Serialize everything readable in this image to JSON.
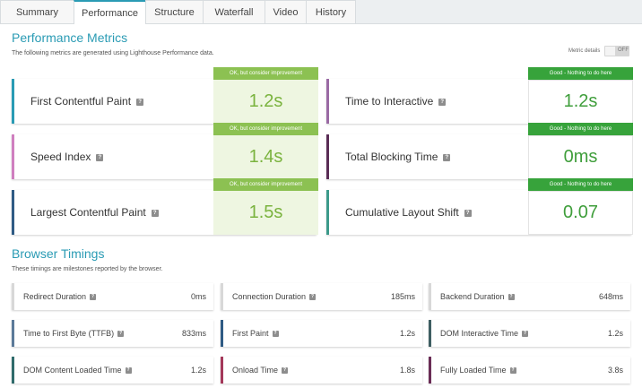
{
  "tabs": [
    "Summary",
    "Performance",
    "Structure",
    "Waterfall",
    "Video",
    "History"
  ],
  "performance": {
    "title": "Performance Metrics",
    "description": "The following metrics are generated using Lighthouse Performance data.",
    "metric_details_label": "Metric details",
    "toggle_label": "OFF",
    "metrics": [
      {
        "name": "First Contentful Paint",
        "badge": "OK, but consider improvement",
        "value": "1.2s",
        "accent": "#2a9bb4"
      },
      {
        "name": "Time to Interactive",
        "badge": "Good - Nothing to do here",
        "value": "1.2s",
        "accent": "#9a6aa4"
      },
      {
        "name": "Speed Index",
        "badge": "OK, but consider improvement",
        "value": "1.4s",
        "accent": "#cf7fbf"
      },
      {
        "name": "Total Blocking Time",
        "badge": "Good - Nothing to do here",
        "value": "0ms",
        "accent": "#5a2d56"
      },
      {
        "name": "Largest Contentful Paint",
        "badge": "OK, but consider improvement",
        "value": "1.5s",
        "accent": "#2f5b84"
      },
      {
        "name": "Cumulative Layout Shift",
        "badge": "Good - Nothing to do here",
        "value": "0.07",
        "accent": "#3c9a8a"
      }
    ]
  },
  "browser": {
    "title": "Browser Timings",
    "description": "These timings are milestones reported by the browser.",
    "timings": [
      {
        "name": "Redirect Duration",
        "value": "0ms",
        "accent": "#d8d8d8"
      },
      {
        "name": "Connection Duration",
        "value": "185ms",
        "accent": "#d8d8d8"
      },
      {
        "name": "Backend Duration",
        "value": "648ms",
        "accent": "#d8d8d8"
      },
      {
        "name": "Time to First Byte (TTFB)",
        "value": "833ms",
        "accent": "#5b7a99"
      },
      {
        "name": "First Paint",
        "value": "1.2s",
        "accent": "#2f5b84"
      },
      {
        "name": "DOM Interactive Time",
        "value": "1.2s",
        "accent": "#3e5e62"
      },
      {
        "name": "DOM Content Loaded Time",
        "value": "1.2s",
        "accent": "#2f6b6b"
      },
      {
        "name": "Onload Time",
        "value": "1.8s",
        "accent": "#a4385a"
      },
      {
        "name": "Fully Loaded Time",
        "value": "3.8s",
        "accent": "#6a2c55"
      }
    ]
  },
  "colors": {
    "ok_badge": "#8cc152",
    "ok_value_bg": "#eef6e1",
    "ok_value_text": "#7ab33e",
    "good_badge": "#37a33b",
    "good_value_text": "#3f9e3b"
  }
}
